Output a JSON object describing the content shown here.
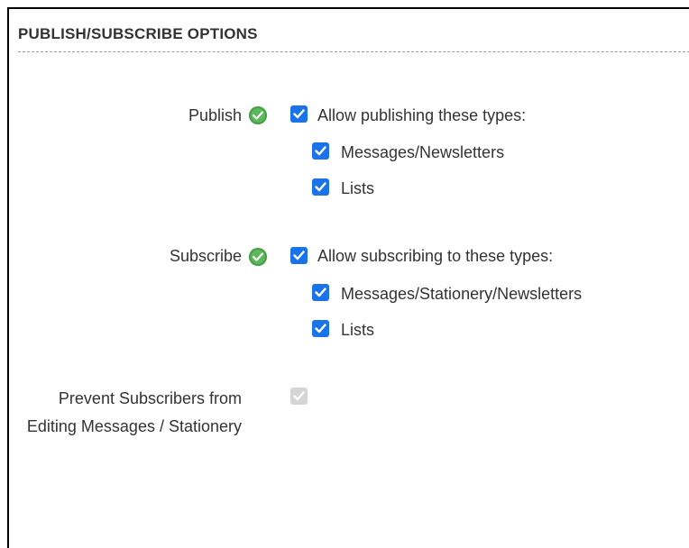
{
  "section": {
    "title": "PUBLISH/SUBSCRIBE OPTIONS"
  },
  "publish": {
    "label": "Publish",
    "status_icon": "check-circle-icon",
    "main_option": {
      "label": "Allow publishing these types:",
      "checked": true
    },
    "types": [
      {
        "label": "Messages/Newsletters",
        "checked": true
      },
      {
        "label": "Lists",
        "checked": true
      }
    ]
  },
  "subscribe": {
    "label": "Subscribe",
    "status_icon": "check-circle-icon",
    "main_option": {
      "label": "Allow subscribing to these types:",
      "checked": true
    },
    "types": [
      {
        "label": "Messages/Stationery/Newsletters",
        "checked": true
      },
      {
        "label": "Lists",
        "checked": true
      }
    ]
  },
  "prevent_editing": {
    "label": "Prevent Subscribers from Editing Messages / Stationery",
    "checked": true,
    "disabled": true
  },
  "colors": {
    "checkbox": "#1a73e8",
    "checkbox_disabled": "#d5d5d5",
    "status_ok": "#5cb85c",
    "text": "#333333"
  }
}
